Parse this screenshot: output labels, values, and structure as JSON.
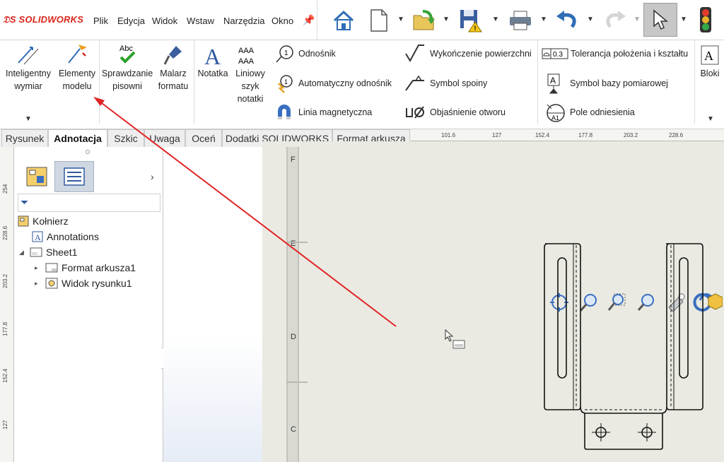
{
  "app": {
    "logo_brand": "SOLIDWORKS"
  },
  "menu": {
    "items": [
      "Plik",
      "Edycja",
      "Widok",
      "Wstaw",
      "Narzędzia",
      "Okno"
    ]
  },
  "ribbon": {
    "smart_dimension": [
      "Inteligentny",
      "wymiar"
    ],
    "model_items": [
      "Elementy",
      "modelu"
    ],
    "spell_check": [
      "Sprawdzanie",
      "pisowni"
    ],
    "format_painter": [
      "Malarz",
      "formatu"
    ],
    "note": "Notatka",
    "linear_note": [
      "Liniowy",
      "szyk",
      "notatki"
    ],
    "balloon": "Odnośnik",
    "auto_balloon": "Automatyczny odnośnik",
    "magnetic_line": "Linia magnetyczna",
    "surface_finish": "Wykończenie powierzchni",
    "weld_symbol": "Symbol spoiny",
    "hole_callout": "Objaśnienie otworu",
    "gtol": "Tolerancja położenia i kształtu",
    "datum_feature": "Symbol bazy pomiarowej",
    "datum_target": "Pole odniesienia",
    "blocks": "Bloki",
    "icon_texts": {
      "abc": "Abc",
      "aaa": "AAA",
      "gtol_box": "0.3",
      "datum_a": "A",
      "datum_a1": "A1",
      "letter_a": "A",
      "num_one": "1"
    }
  },
  "tabs": [
    "Rysunek",
    "Adnotacja",
    "Szkic",
    "Uwaga",
    "Oceń",
    "Dodatki SOLIDWORKS",
    "Format arkusza"
  ],
  "active_tab": "Adnotacja",
  "ruler_top": [
    "101.6",
    "127",
    "152.4",
    "177.8",
    "203.2",
    "228.6"
  ],
  "ruler_left": [
    "254",
    "228.6",
    "203.2",
    "177.8",
    "152.4",
    "127"
  ],
  "feature_tree": {
    "root": "Kołnierz",
    "items": [
      {
        "label": "Annotations",
        "level": 1
      },
      {
        "label": "Sheet1",
        "level": 1
      },
      {
        "label": "Format arkusza1",
        "level": 2
      },
      {
        "label": "Widok rysunku1",
        "level": 2
      }
    ]
  },
  "sheet_zones": [
    "F",
    "E",
    "D",
    "C"
  ],
  "colors": {
    "accent_red": "#d9261c",
    "arrow_red": "#e02424",
    "gfx_bg": "#eaeae2"
  }
}
